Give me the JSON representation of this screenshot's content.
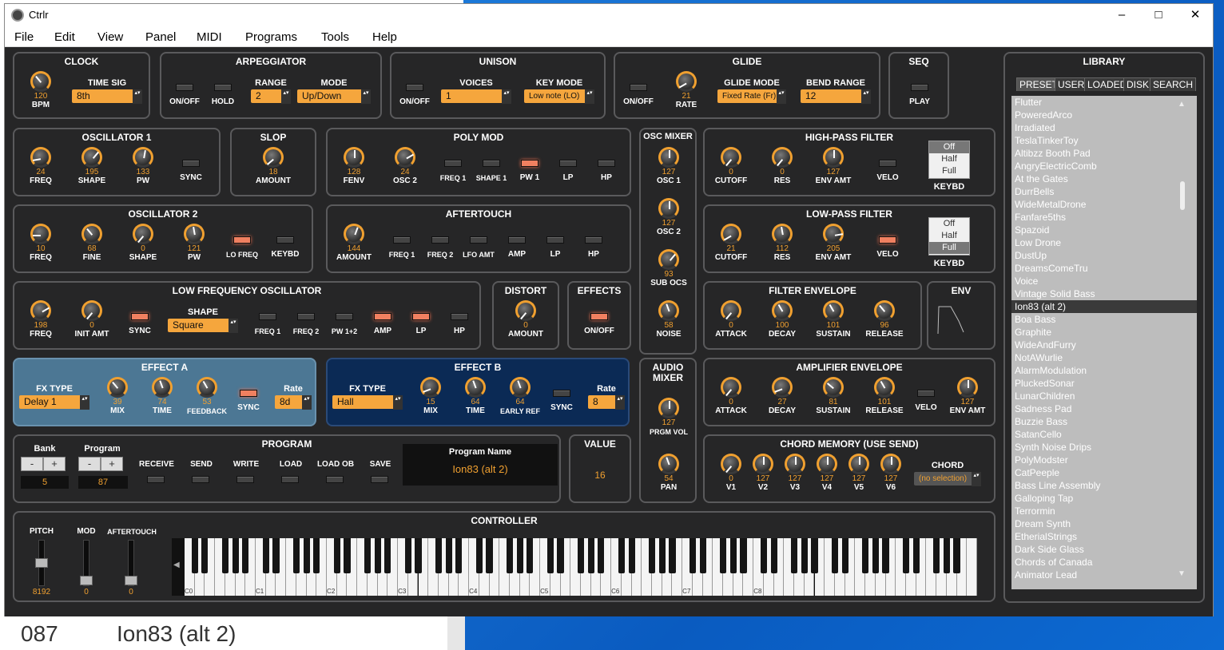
{
  "background": {
    "number": "087",
    "name": "Ion83 (alt 2)"
  },
  "window": {
    "title": "Ctrlr",
    "min": "–",
    "max": "□",
    "close": "✕"
  },
  "menu": [
    "File",
    "Edit",
    "View",
    "Panel",
    "MIDI",
    "Programs",
    "Tools",
    "Help"
  ],
  "clock": {
    "title": "CLOCK",
    "bpm_value": "120",
    "bpm_label": "BPM",
    "timesig_label": "TIME SIG",
    "timesig": "8th"
  },
  "arp": {
    "title": "ARPEGGIATOR",
    "onoff": "ON/OFF",
    "hold": "HOLD",
    "range_label": "RANGE",
    "range": "2",
    "mode_label": "MODE",
    "mode": "Up/Down"
  },
  "unison": {
    "title": "UNISON",
    "onoff": "ON/OFF",
    "voices_label": "VOICES",
    "voices": "1",
    "keymode_label": "KEY MODE",
    "keymode": "Low note (LO)"
  },
  "glide": {
    "title": "GLIDE",
    "onoff": "ON/OFF",
    "rate_value": "21",
    "rate_label": "RATE",
    "mode_label": "GLIDE MODE",
    "mode": "Fixed Rate (Fr)",
    "bend_label": "BEND RANGE",
    "bend": "12"
  },
  "seq": {
    "title": "SEQ",
    "play": "PLAY"
  },
  "osc1": {
    "title": "OSCILLATOR 1",
    "freq": "24",
    "freq_l": "FREQ",
    "shape": "195",
    "shape_l": "SHAPE",
    "pw": "133",
    "pw_l": "PW",
    "sync": "SYNC"
  },
  "slop": {
    "title": "SLOP",
    "amount": "18",
    "amount_l": "AMOUNT"
  },
  "polymod": {
    "title": "POLY MOD",
    "fenv": "128",
    "fenv_l": "FENV",
    "osc2": "24",
    "osc2_l": "OSC 2",
    "b1": "FREQ 1",
    "b2": "SHAPE 1",
    "b3": "PW 1",
    "b4": "LP",
    "b5": "HP"
  },
  "oscmixer": {
    "title": "OSC MIXER",
    "osc1": "127",
    "osc1_l": "OSC 1",
    "osc2": "127",
    "osc2_l": "OSC 2",
    "sub": "93",
    "sub_l": "SUB OCS",
    "noise": "58",
    "noise_l": "NOISE"
  },
  "hpf": {
    "title": "HIGH-PASS FILTER",
    "cutoff": "0",
    "cutoff_l": "CUTOFF",
    "res": "0",
    "res_l": "RES",
    "env": "127",
    "env_l": "ENV AMT",
    "velo": "VELO",
    "keybd": "KEYBD",
    "opts": [
      "Off",
      "Half",
      "Full"
    ]
  },
  "osc2": {
    "title": "OSCILLATOR 2",
    "freq": "10",
    "freq_l": "FREQ",
    "fine": "68",
    "fine_l": "FINE",
    "shape": "0",
    "shape_l": "SHAPE",
    "pw": "121",
    "pw_l": "PW",
    "lofreq": "LO FREQ",
    "keybd": "KEYBD"
  },
  "aftertouch": {
    "title": "AFTERTOUCH",
    "amount": "144",
    "amount_l": "AMOUNT",
    "b1": "FREQ 1",
    "b2": "FREQ 2",
    "b3": "LFO AMT",
    "b4": "AMP",
    "b5": "LP",
    "b6": "HP"
  },
  "lpf": {
    "title": "LOW-PASS FILTER",
    "cutoff": "21",
    "cutoff_l": "CUTOFF",
    "res": "112",
    "res_l": "RES",
    "env": "205",
    "env_l": "ENV AMT",
    "velo": "VELO",
    "keybd": "KEYBD",
    "opts": [
      "Off",
      "Half",
      "Full"
    ]
  },
  "lfo": {
    "title": "LOW FREQUENCY OSCILLATOR",
    "freq": "198",
    "freq_l": "FREQ",
    "init": "0",
    "init_l": "INIT AMT",
    "sync": "SYNC",
    "shape_label": "SHAPE",
    "shape": "Square",
    "b1": "FREQ 1",
    "b2": "FREQ 2",
    "b3": "PW 1+2",
    "b4": "AMP",
    "b5": "LP",
    "b6": "HP"
  },
  "distort": {
    "title": "DISTORT",
    "amount": "0",
    "amount_l": "AMOUNT"
  },
  "effects": {
    "title": "EFFECTS",
    "onoff": "ON/OFF"
  },
  "fenv": {
    "title": "FILTER ENVELOPE",
    "attack": "0",
    "attack_l": "ATTACK",
    "decay": "100",
    "decay_l": "DECAY",
    "sustain": "101",
    "sustain_l": "SUSTAIN",
    "release": "96",
    "release_l": "RELEASE"
  },
  "env": {
    "title": "ENV"
  },
  "effa": {
    "title": "EFFECT A",
    "fxtype_label": "FX TYPE",
    "fxtype": "Delay 1",
    "mix": "39",
    "mix_l": "MIX",
    "time": "74",
    "time_l": "TIME",
    "fb": "53",
    "fb_l": "FEEDBACK",
    "sync": "SYNC",
    "rate_label": "Rate",
    "rate": "8d"
  },
  "effb": {
    "title": "EFFECT B",
    "fxtype_label": "FX TYPE",
    "fxtype": "Hall",
    "mix": "15",
    "mix_l": "MIX",
    "time": "64",
    "time_l": "TIME",
    "er": "64",
    "er_l": "EARLY REF",
    "sync": "SYNC",
    "rate_label": "Rate",
    "rate": "8"
  },
  "audiomixer": {
    "title1": "AUDIO",
    "title2": "MIXER",
    "vol": "127",
    "vol_l": "PRGM VOL",
    "pan": "54",
    "pan_l": "PAN"
  },
  "aenv": {
    "title": "AMPLIFIER ENVELOPE",
    "attack": "0",
    "attack_l": "ATTACK",
    "decay": "27",
    "decay_l": "DECAY",
    "sustain": "81",
    "sustain_l": "SUSTAIN",
    "release": "101",
    "release_l": "RELEASE",
    "velo": "VELO",
    "env": "127",
    "env_l": "ENV AMT"
  },
  "program": {
    "title": "PROGRAM",
    "bank_label": "Bank",
    "bank": "5",
    "prog_label": "Program",
    "prog": "87",
    "minus": "-",
    "plus": "+",
    "receive": "RECEIVE",
    "send": "SEND",
    "write": "WRITE",
    "load": "LOAD",
    "loadob": "LOAD OB",
    "save": "SAVE",
    "name_label": "Program Name",
    "name": "Ion83 (alt 2)"
  },
  "value": {
    "title": "VALUE",
    "value": "16"
  },
  "chord": {
    "title": "CHORD MEMORY (USE SEND)",
    "v1": "0",
    "v1_l": "V1",
    "v2": "127",
    "v2_l": "V2",
    "v3": "127",
    "v3_l": "V3",
    "v4": "127",
    "v4_l": "V4",
    "v5": "127",
    "v5_l": "V5",
    "v6": "127",
    "v6_l": "V6",
    "chord_label": "CHORD",
    "chord": "(no selection)"
  },
  "controller": {
    "title": "CONTROLLER",
    "pitch_l": "PITCH",
    "pitch": "8192",
    "mod_l": "MOD",
    "mod": "0",
    "at_l": "AFTERTOUCH",
    "at": "0",
    "octaves": [
      "C0",
      "C1",
      "C2",
      "C3",
      "C4",
      "C5",
      "C6",
      "C7",
      "C8"
    ]
  },
  "library": {
    "title": "LIBRARY",
    "tabs": [
      "PRESET",
      "USER",
      "LOADED",
      "DISK",
      "SEARCH"
    ],
    "selected": "Ion83 (alt 2)",
    "items": [
      "Flutter",
      "PoweredArco",
      "Irradiated",
      "TeslaTinkerToy",
      "Altibzz Booth Pad",
      "AngryElectricComb",
      "At the Gates",
      "DurrBells",
      "WideMetalDrone",
      "Fanfare5ths",
      "Spazoid",
      "Low Drone",
      "DustUp",
      "DreamsComeTru",
      "Voice",
      "Vintage Solid Bass",
      "Ion83 (alt 2)",
      "Boa Bass",
      "Graphite",
      "WideAndFurry",
      "NotAWurlie",
      "AlarmModulation",
      "PluckedSonar",
      "LunarChildren",
      "Sadness Pad",
      "Buzzie Bass",
      "SatanCello",
      "Synth Noise Drips",
      "PolyModster",
      "CatPeeple",
      "Bass Line Assembly",
      "Galloping Tap",
      "Terrormin",
      "Dream Synth",
      "EtherialStrings",
      "Dark Side Glass",
      "Chords of Canada",
      "Animator Lead"
    ]
  }
}
